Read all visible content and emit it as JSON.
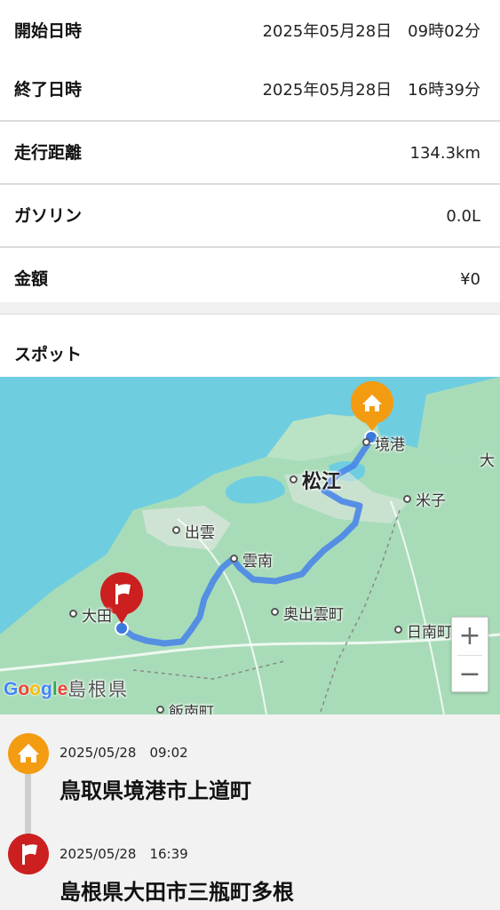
{
  "info": {
    "start_label": "開始日時",
    "start_value": "2025年05月28日　09時02分",
    "end_label": "終了日時",
    "end_value": "2025年05月28日　16時39分",
    "distance_label": "走行距離",
    "distance_value": "134.3km",
    "gasoline_label": "ガソリン",
    "gasoline_value": "0.0L",
    "amount_label": "金額",
    "amount_value": "¥0"
  },
  "spots": {
    "title": "スポット"
  },
  "map": {
    "labels": {
      "sakaiminato": "境港",
      "matsue": "松江",
      "yonago": "米子",
      "izumo": "出雲",
      "unnan": "雲南",
      "okuizumo": "奥出雲町",
      "oda": "大田",
      "nichinan": "日南町",
      "shimane_pref": "島根県",
      "iinan": "飯南町",
      "edge_label": "大"
    },
    "zoom_in": "+",
    "zoom_out": "−",
    "attribution": "Google",
    "colors": {
      "route": "#4a86e8",
      "start_marker": "#f39c12",
      "end_marker": "#cc1f1f",
      "sea": "#6fcde0",
      "land": "#a8dcb8"
    }
  },
  "timeline": {
    "start": {
      "icon": "home-icon",
      "time": "2025/05/28　09:02",
      "place": "鳥取県境港市上道町"
    },
    "end": {
      "icon": "flag-icon",
      "time": "2025/05/28　16:39",
      "place": "島根県大田市三瓶町多根"
    }
  }
}
